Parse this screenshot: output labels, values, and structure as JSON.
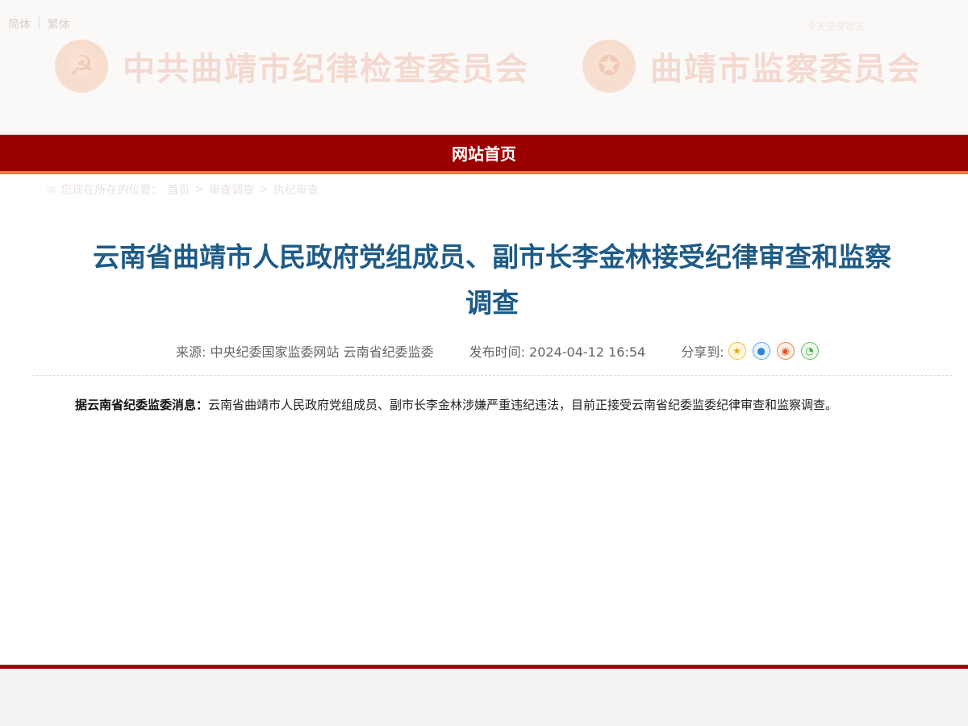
{
  "header": {
    "lang_simplified": "简体",
    "lang_separator": "|",
    "lang_traditional": "繁体",
    "top_right_text": "今天是星期五",
    "brand_left": "中共曲靖市纪律检查委员会",
    "brand_right": "曲靖市监察委员会"
  },
  "nav": {
    "home_label": "网站首页"
  },
  "breadcrumb": {
    "prefix": "您现在所在的位置：",
    "items": [
      "首页",
      "审查调查",
      "执纪审查"
    ],
    "separator": ">"
  },
  "article": {
    "title_line1": "云南省曲靖市人民政府党组成员、副市长李金林接受纪律审查和监察",
    "title_line2": "调查",
    "source": "来源: 中央纪委国家监委网站 云南省纪委监委",
    "publish_time": "发布时间: 2024-04-12 16:54",
    "share_label": "分享到:",
    "lead": "据云南省纪委监委消息：",
    "body": "云南省曲靖市人民政府党组成员、副市长李金林涉嫌严重违纪违法，目前正接受云南省纪委监委纪律审查和监察调查。"
  },
  "share_icons": [
    "star-icon",
    "qq-icon",
    "weibo-icon",
    "wechat-icon"
  ],
  "colors": {
    "nav_red": "#9b0000",
    "nav_accent_orange": "#f07a38",
    "title_blue": "#1e5b87",
    "footer_red": "#a00000"
  }
}
